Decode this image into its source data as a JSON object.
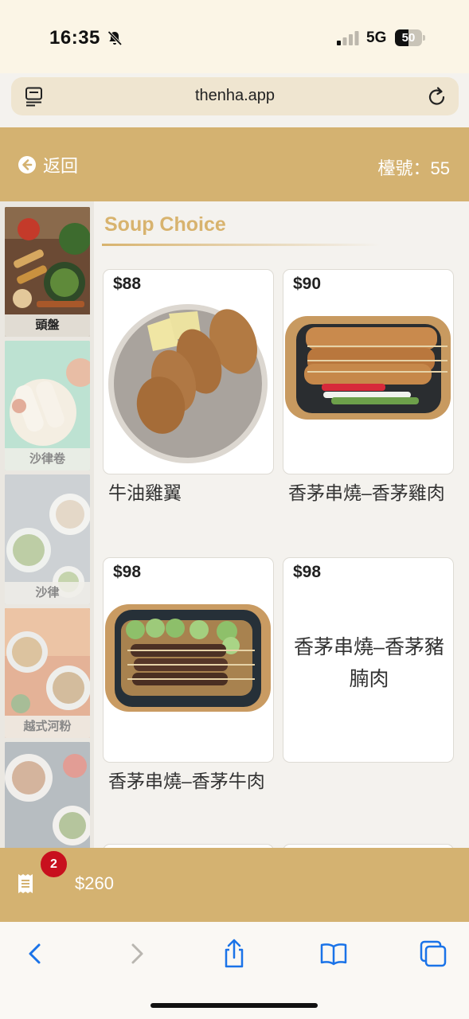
{
  "status_bar": {
    "time": "16:35",
    "network": "5G",
    "battery": "50"
  },
  "browser": {
    "url": "thenha.app"
  },
  "header": {
    "back_label": "返回",
    "table_label": "檯號：55"
  },
  "sidebar": {
    "categories": [
      {
        "label": "頭盤",
        "active": true
      },
      {
        "label": "沙律卷",
        "active": false
      },
      {
        "label": "沙律",
        "active": false
      },
      {
        "label": "越式河粉",
        "active": false
      },
      {
        "label": "",
        "active": false
      }
    ]
  },
  "section": {
    "title": "Soup Choice"
  },
  "items": [
    {
      "price": "$88",
      "name": "牛油雞翼"
    },
    {
      "price": "$90",
      "name": "香茅串燒–香茅雞肉"
    },
    {
      "price": "$98",
      "name": "香茅串燒–香茅牛肉"
    },
    {
      "price": "$98",
      "name": "香茅串燒–香茅豬腩肉",
      "image_text": "香茅串燒–香茅豬腩肉"
    }
  ],
  "cart": {
    "count": "2",
    "total": "$260"
  },
  "colors": {
    "gold": "#d4b271",
    "title_gold": "#d8b36e",
    "badge_red": "#c8101e",
    "ios_blue": "#1a73e8"
  },
  "icons": [
    "bell-slash-icon",
    "signal-icon",
    "battery-icon",
    "reader-icon",
    "reload-icon",
    "back-arrow-icon",
    "receipt-icon",
    "chevron-left-icon",
    "chevron-right-icon",
    "share-icon",
    "bookmarks-icon",
    "tabs-icon"
  ]
}
